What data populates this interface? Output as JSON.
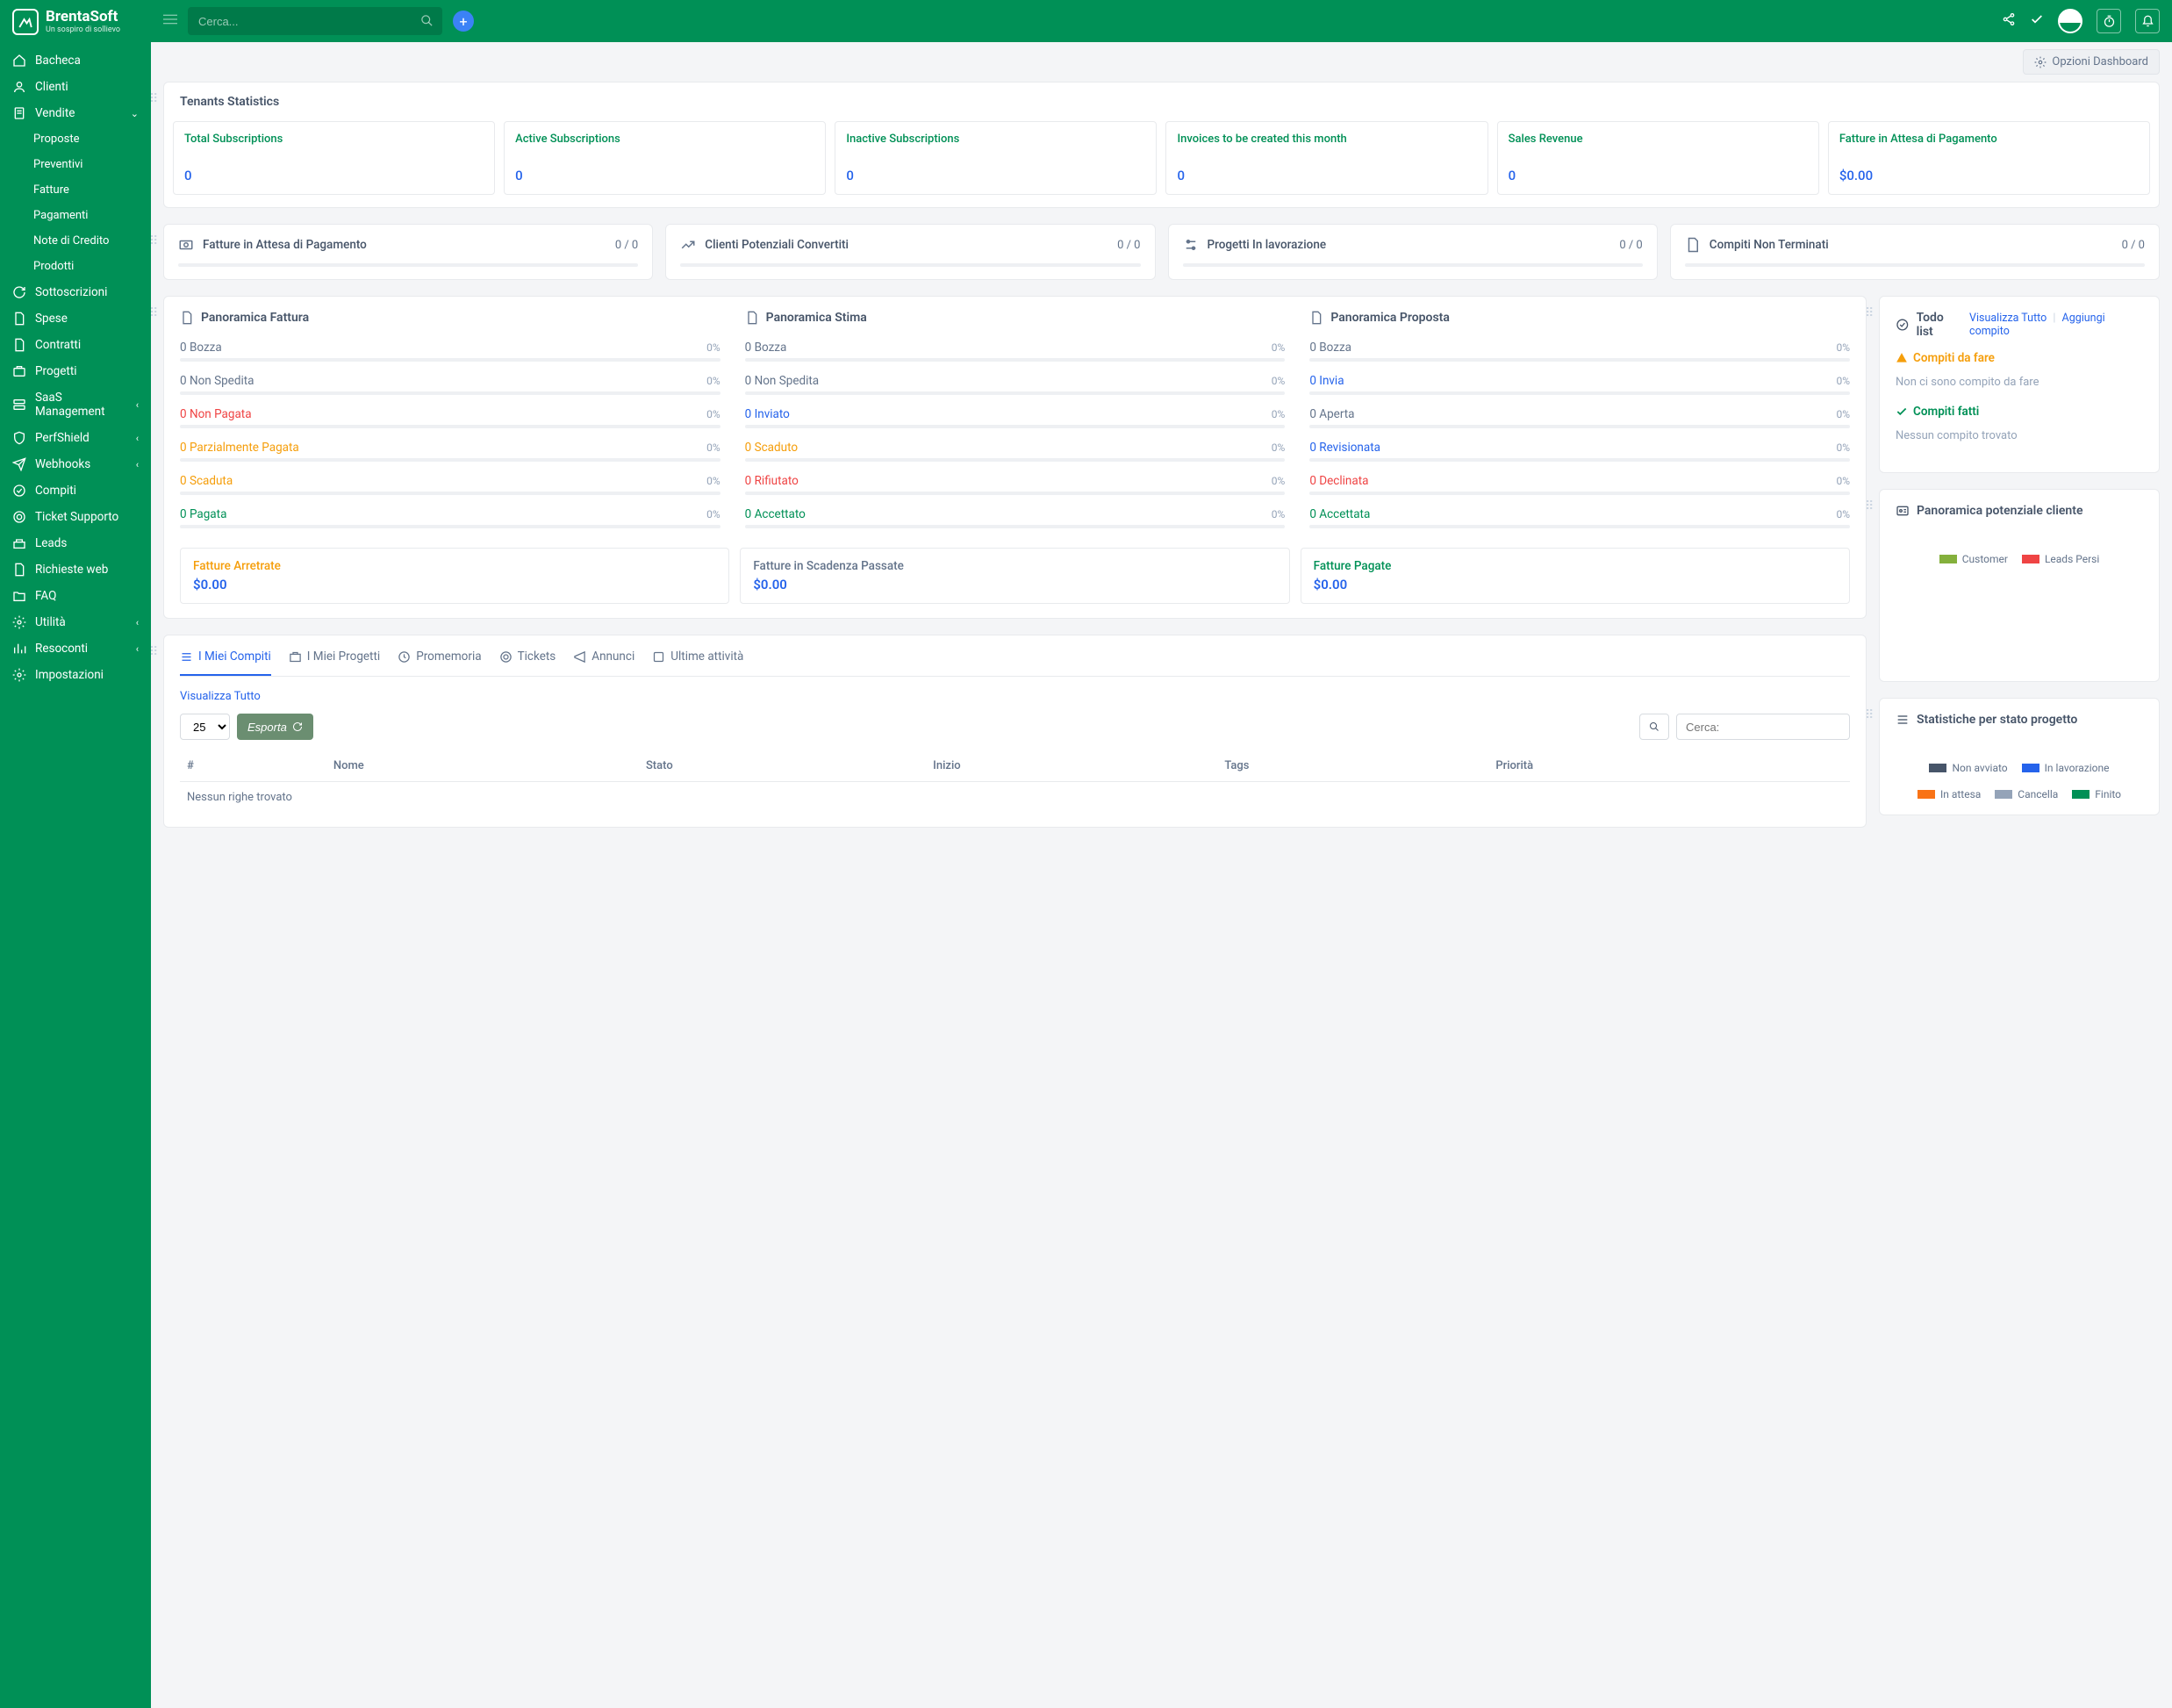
{
  "brand": {
    "name": "BrentaSoft",
    "tagline": "Un sospiro di sollievo"
  },
  "search": {
    "placeholder": "Cerca..."
  },
  "dashboard_options": "Opzioni Dashboard",
  "sidebar": {
    "items": [
      {
        "label": "Bacheca"
      },
      {
        "label": "Clienti"
      },
      {
        "label": "Vendite"
      }
    ],
    "vendite_sub": [
      {
        "label": "Proposte"
      },
      {
        "label": "Preventivi"
      },
      {
        "label": "Fatture"
      },
      {
        "label": "Pagamenti"
      },
      {
        "label": "Note di Credito"
      },
      {
        "label": "Prodotti"
      }
    ],
    "rest": [
      {
        "label": "Sottoscrizioni"
      },
      {
        "label": "Spese"
      },
      {
        "label": "Contratti"
      },
      {
        "label": "Progetti"
      },
      {
        "label": "SaaS Management",
        "exp": true
      },
      {
        "label": "PerfShield",
        "exp": true
      },
      {
        "label": "Webhooks",
        "exp": true
      },
      {
        "label": "Compiti"
      },
      {
        "label": "Ticket Supporto"
      },
      {
        "label": "Leads"
      },
      {
        "label": "Richieste web"
      },
      {
        "label": "FAQ"
      },
      {
        "label": "Utilità",
        "exp": true
      },
      {
        "label": "Resoconti",
        "exp": true
      },
      {
        "label": "Impostazioni"
      }
    ]
  },
  "tenants": {
    "title": "Tenants Statistics",
    "items": [
      {
        "label": "Total Subscriptions",
        "value": "0"
      },
      {
        "label": "Active Subscriptions",
        "value": "0"
      },
      {
        "label": "Inactive Subscriptions",
        "value": "0"
      },
      {
        "label": "Invoices to be created this month",
        "value": "0"
      },
      {
        "label": "Sales Revenue",
        "value": "0"
      },
      {
        "label": "Fatture in Attesa di Pagamento",
        "value": "$0.00"
      }
    ]
  },
  "minis": [
    {
      "title": "Fatture in Attesa di Pagamento",
      "value": "0 / 0"
    },
    {
      "title": "Clienti Potenziali Convertiti",
      "value": "0 / 0"
    },
    {
      "title": "Progetti In lavorazione",
      "value": "0 / 0"
    },
    {
      "title": "Compiti Non Terminati",
      "value": "0 / 0"
    }
  ],
  "overview": {
    "fattura": {
      "title": "Panoramica Fattura",
      "rows": [
        {
          "n": "0",
          "label": "Bozza",
          "pct": "0%",
          "cls": "c-gray"
        },
        {
          "n": "0",
          "label": "Non Spedita",
          "pct": "0%",
          "cls": "c-gray"
        },
        {
          "n": "0",
          "label": "Non Pagata",
          "pct": "0%",
          "cls": "c-red"
        },
        {
          "n": "0",
          "label": "Parzialmente Pagata",
          "pct": "0%",
          "cls": "c-orange"
        },
        {
          "n": "0",
          "label": "Scaduta",
          "pct": "0%",
          "cls": "c-orange"
        },
        {
          "n": "0",
          "label": "Pagata",
          "pct": "0%",
          "cls": "c-green"
        }
      ]
    },
    "stima": {
      "title": "Panoramica Stima",
      "rows": [
        {
          "n": "0",
          "label": "Bozza",
          "pct": "0%",
          "cls": "c-gray"
        },
        {
          "n": "0",
          "label": "Non Spedita",
          "pct": "0%",
          "cls": "c-gray"
        },
        {
          "n": "0",
          "label": "Inviato",
          "pct": "0%",
          "cls": "c-blue"
        },
        {
          "n": "0",
          "label": "Scaduto",
          "pct": "0%",
          "cls": "c-orange"
        },
        {
          "n": "0",
          "label": "Rifiutato",
          "pct": "0%",
          "cls": "c-red"
        },
        {
          "n": "0",
          "label": "Accettato",
          "pct": "0%",
          "cls": "c-green"
        }
      ]
    },
    "proposta": {
      "title": "Panoramica Proposta",
      "rows": [
        {
          "n": "0",
          "label": "Bozza",
          "pct": "0%",
          "cls": "c-gray"
        },
        {
          "n": "0",
          "label": "Invia",
          "pct": "0%",
          "cls": "c-blue"
        },
        {
          "n": "0",
          "label": "Aperta",
          "pct": "0%",
          "cls": "c-gray"
        },
        {
          "n": "0",
          "label": "Revisionata",
          "pct": "0%",
          "cls": "c-blue"
        },
        {
          "n": "0",
          "label": "Declinata",
          "pct": "0%",
          "cls": "c-red"
        },
        {
          "n": "0",
          "label": "Accettata",
          "pct": "0%",
          "cls": "c-green"
        }
      ]
    }
  },
  "sums": [
    {
      "title": "Fatture Arretrate",
      "value": "$0.00",
      "cls": "c-orange"
    },
    {
      "title": "Fatture in Scadenza Passate",
      "value": "$0.00",
      "cls": "c-gray"
    },
    {
      "title": "Fatture Pagate",
      "value": "$0.00",
      "cls": "c-green"
    }
  ],
  "todo": {
    "title": "Todo list",
    "view_all": "Visualizza Tutto",
    "add": "Aggiungi compito",
    "pending_title": "Compiti da fare",
    "pending_empty": "Non ci sono compito da fare",
    "done_title": "Compiti fatti",
    "done_empty": "Nessun compito trovato"
  },
  "leads": {
    "title": "Panoramica potenziale cliente",
    "legend": [
      {
        "label": "Customer",
        "color": "#84b03c"
      },
      {
        "label": "Leads Persi",
        "color": "#ef4444"
      }
    ]
  },
  "tabs": {
    "items": [
      {
        "label": "I Miei Compiti",
        "active": true
      },
      {
        "label": "I Miei Progetti"
      },
      {
        "label": "Promemoria"
      },
      {
        "label": "Tickets"
      },
      {
        "label": "Annunci"
      },
      {
        "label": "Ultime attività"
      }
    ],
    "view_all": "Visualizza Tutto",
    "pagesize": "25",
    "export": "Esporta",
    "search_placeholder": "Cerca:",
    "cols": [
      "#",
      "Nome",
      "Stato",
      "Inizio",
      "Tags",
      "Priorità"
    ],
    "empty": "Nessun righe trovato"
  },
  "proj": {
    "title": "Statistiche per stato progetto",
    "legend": [
      {
        "label": "Non avviato",
        "color": "#475569"
      },
      {
        "label": "In lavorazione",
        "color": "#2563eb"
      },
      {
        "label": "In attesa",
        "color": "#f97316"
      },
      {
        "label": "Cancella",
        "color": "#94a3b8"
      },
      {
        "label": "Finito",
        "color": "#009056"
      }
    ]
  }
}
